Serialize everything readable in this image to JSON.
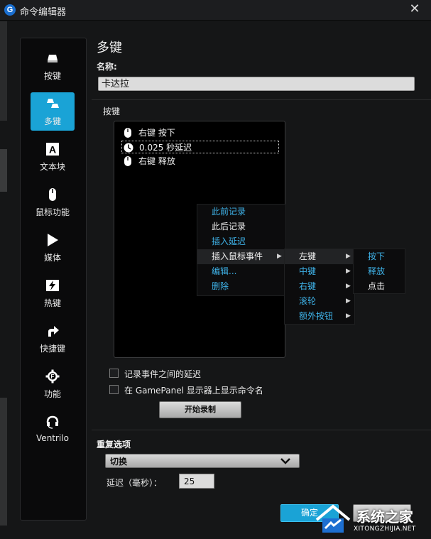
{
  "window": {
    "title": "命令编辑器",
    "close_glyph": "✕"
  },
  "sidebar": {
    "items": [
      {
        "label": "按键",
        "icon": "key-icon"
      },
      {
        "label": "多键",
        "icon": "multikey-icon",
        "active": true
      },
      {
        "label": "文本块",
        "icon": "text-block-icon"
      },
      {
        "label": "鼠标功能",
        "icon": "mouse-icon"
      },
      {
        "label": "媒体",
        "icon": "play-icon"
      },
      {
        "label": "热键",
        "icon": "hotkey-icon"
      },
      {
        "label": "快捷键",
        "icon": "shortcut-arrow-icon"
      },
      {
        "label": "功能",
        "icon": "function-gear-icon"
      },
      {
        "label": "Ventrilo",
        "icon": "headset-icon"
      }
    ]
  },
  "main": {
    "heading": "多键",
    "name_label": "名称:",
    "name_value": "卡达拉",
    "keys_label": "按键",
    "events": [
      {
        "icon": "mouse-icon",
        "text": "右键 按下"
      },
      {
        "icon": "clock-icon",
        "text": "0.025 秒延迟",
        "selected": true
      },
      {
        "icon": "mouse-icon",
        "text": "右键 释放"
      }
    ],
    "record_delay_checkbox": "记录事件之间的延迟",
    "show_name_checkbox": "在 GamePanel 显示器上显示命令名",
    "record_button": "开始录制",
    "repeat_label": "重复选项",
    "repeat_value": "切换",
    "delay_label": "延迟（毫秒）：",
    "delay_value": "25",
    "ok_button": "确定"
  },
  "context_menu": {
    "items": [
      "此前记录",
      "此后记录",
      "插入延迟",
      "插入鼠标事件",
      "编辑...",
      "删除"
    ]
  },
  "mouse_submenu": {
    "items": [
      "左键",
      "中键",
      "右键",
      "滚轮",
      "额外按钮"
    ]
  },
  "action_submenu": {
    "items": [
      "按下",
      "释放",
      "点击"
    ]
  },
  "watermark": {
    "main": "系统之家",
    "sub": "XITONGZHIJIA.NET"
  },
  "colors": {
    "accent": "#1aa3d6",
    "menu_blue": "#3fb4ea",
    "background": "#151617"
  }
}
